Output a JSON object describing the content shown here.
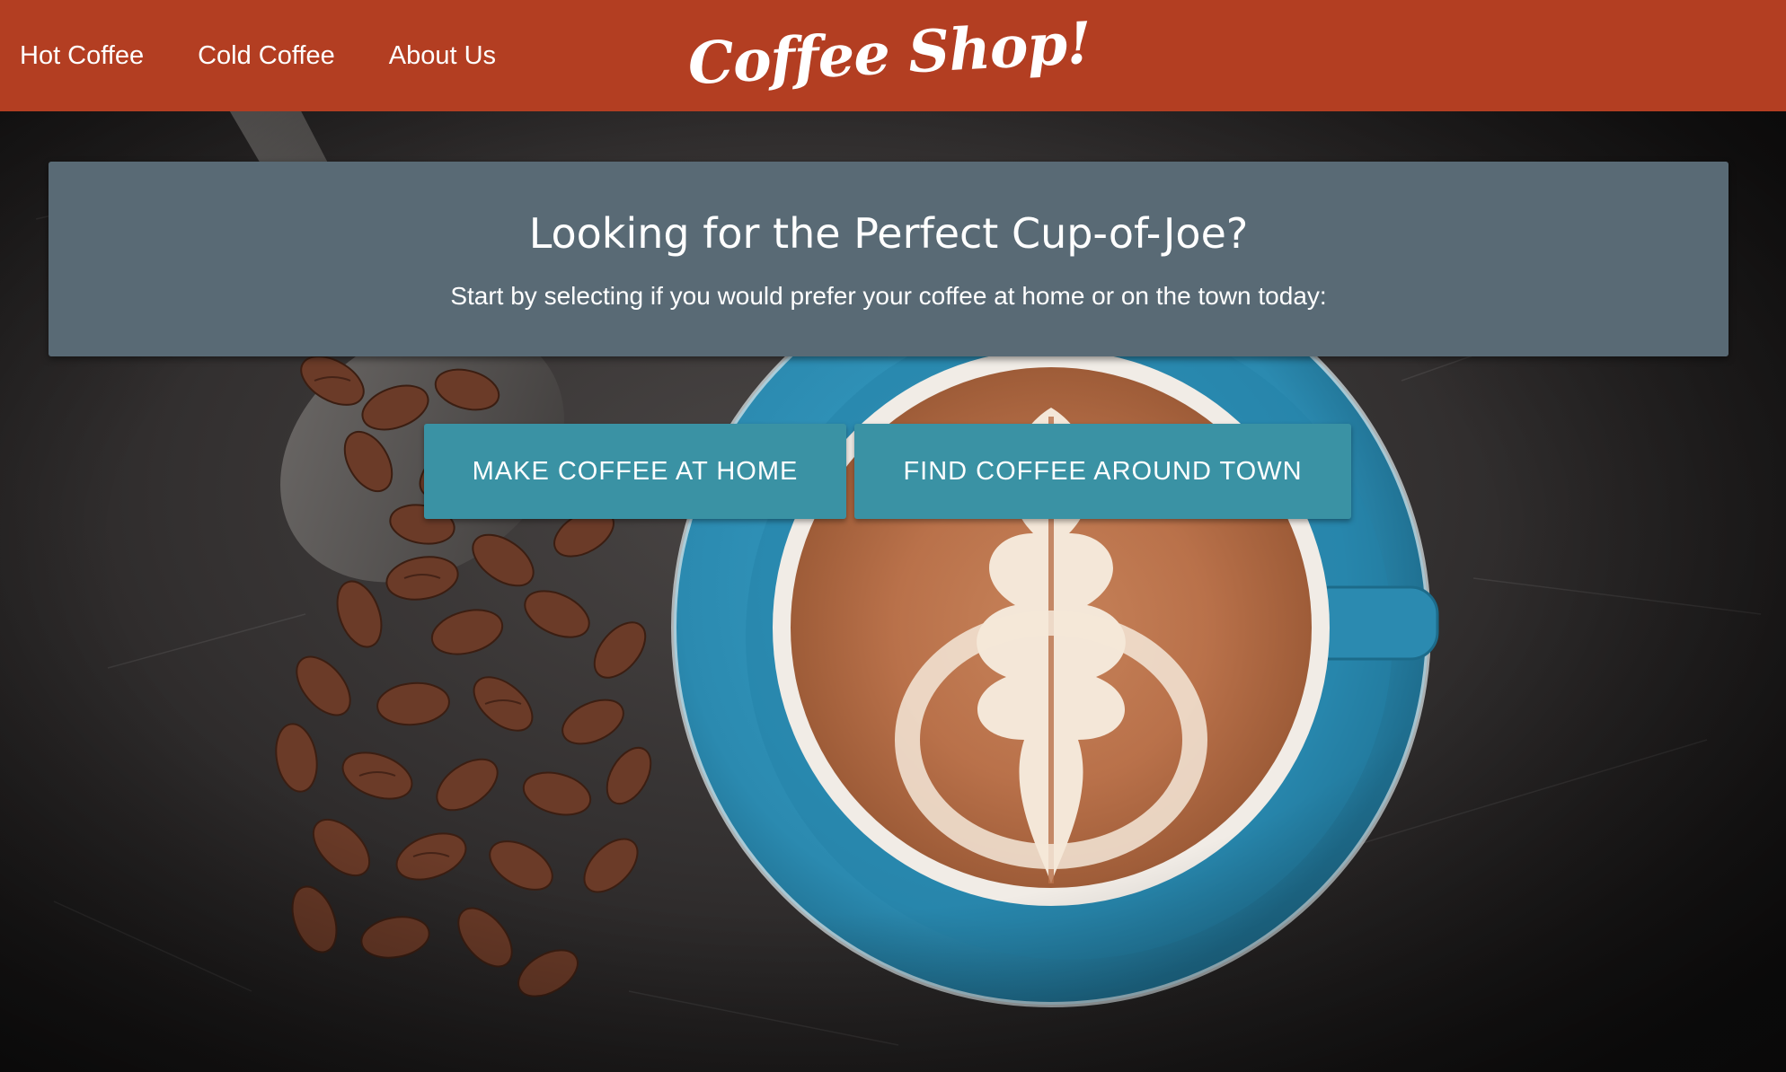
{
  "nav": {
    "links": [
      {
        "label": "Hot Coffee"
      },
      {
        "label": "Cold Coffee"
      },
      {
        "label": "About Us"
      }
    ],
    "brand": "Coffee Shop!"
  },
  "intro": {
    "title": "Looking for the Perfect Cup-of-Joe?",
    "subtitle": "Start by selecting if you would prefer your coffee at home or on the town today:"
  },
  "actions": {
    "home_label": "MAKE COFFEE AT HOME",
    "town_label": "FIND COFFEE AROUND TOWN"
  },
  "colors": {
    "navbar": "#b33e22",
    "panel": "#596a75",
    "button": "#3a92a4",
    "saucer": "#2f8fb5"
  }
}
